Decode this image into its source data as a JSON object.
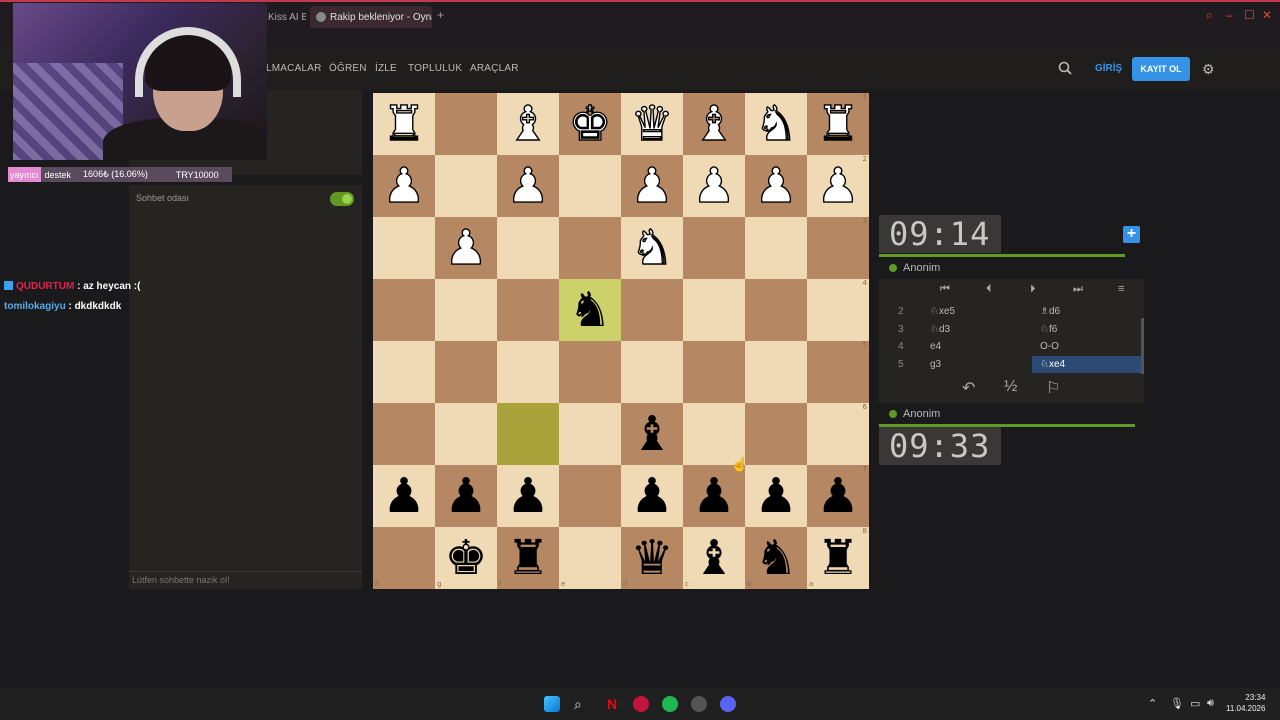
{
  "browser": {
    "tabs": [
      {
        "label": "Kiss AI Ba"
      },
      {
        "label": "Rakip bekleniyor - Oyna Al"
      }
    ],
    "newtab": "+",
    "window_controls": [
      "–",
      "☐",
      "✕"
    ]
  },
  "header": {
    "nav": [
      "LMACALAR",
      "ÖĞREN",
      "İZLE",
      "TOPLULUK",
      "ARAÇLAR"
    ],
    "login": "GİRİŞ",
    "signup": "KAYIT OL"
  },
  "stream": {
    "label1": "yayıncı",
    "label2": "destek",
    "progress": "1606₺ (16.06%)",
    "goal": "TRY10000",
    "chat": [
      {
        "user": "QUDURTUM",
        "msg": ": az heycan :("
      },
      {
        "user": "tomilokagiyu",
        "msg": ": dkdkdkdk"
      }
    ]
  },
  "chat": {
    "title": "Sohbet odası",
    "toggle_on": true,
    "placeholder": "Lütfen sohbette nazik ol!"
  },
  "board": {
    "orientation": "black",
    "rows": [
      [
        "wR",
        "",
        "wB",
        "wK",
        "wQ",
        "wB",
        "wN",
        "wR"
      ],
      [
        "wP",
        "",
        "wP",
        "",
        "wP",
        "wP",
        "wP",
        "wP"
      ],
      [
        "",
        "wP",
        "",
        "",
        "wN",
        "",
        "",
        ""
      ],
      [
        "",
        "",
        "",
        "bN",
        "",
        "",
        "",
        ""
      ],
      [
        "",
        "",
        "",
        "",
        "",
        "",
        "",
        ""
      ],
      [
        "",
        "",
        "",
        "",
        "bB",
        "",
        "",
        ""
      ],
      [
        "bP",
        "bP",
        "bP",
        "",
        "bP",
        "bP",
        "bP",
        "bP"
      ],
      [
        "",
        "bK",
        "bR",
        "",
        "bQ",
        "bB",
        "bN",
        "bR"
      ]
    ],
    "highlight": [
      [
        3,
        3
      ],
      [
        5,
        2
      ]
    ],
    "rank_labels": [
      "1",
      "2",
      "3",
      "4",
      "5",
      "6",
      "7",
      "8"
    ],
    "file_labels": [
      "h",
      "g",
      "f",
      "e",
      "d",
      "c",
      "b",
      "a"
    ]
  },
  "clocks": {
    "top": "09:14",
    "bottom": "09:33",
    "top_player": "Anonim",
    "bottom_player": "Anonim"
  },
  "moves": [
    {
      "n": "2",
      "w": "♘xe5",
      "b": "♗d6"
    },
    {
      "n": "3",
      "w": "♘d3",
      "b": "♘f6"
    },
    {
      "n": "4",
      "w": "e4",
      "b": "O-O"
    },
    {
      "n": "5",
      "w": "g3",
      "b": "♘xe4"
    }
  ],
  "actions": {
    "takeback": "↶",
    "draw": "½",
    "resign": "⚐"
  },
  "taskbar": {
    "time": "23:34",
    "date": "11.04.2026"
  },
  "colors": {
    "accent": "#3692e7",
    "green": "#629924",
    "light_square": "#f0d9b5",
    "dark_square": "#b58863"
  }
}
